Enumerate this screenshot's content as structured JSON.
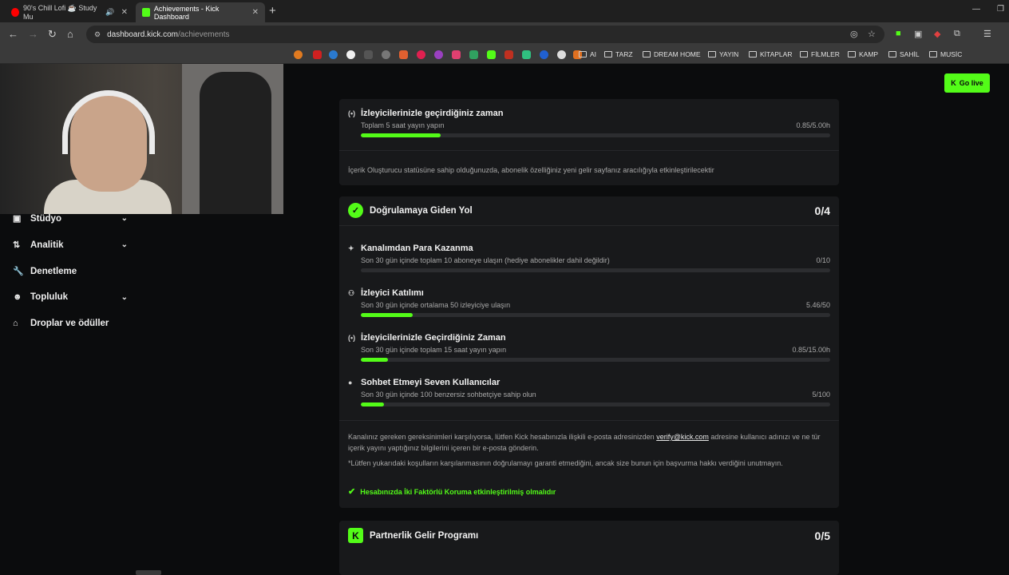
{
  "browser": {
    "tabs": [
      {
        "title": "90's Chill Lofi ☕ Study Mu",
        "favicon_color": "#ff0000"
      },
      {
        "title": "Achievements - Kick Dashboard",
        "favicon_color": "#53fc18"
      }
    ],
    "url_host": "dashboard.kick.com",
    "url_path": "/achievements",
    "bookmark_folders": [
      "AI",
      "TARZ",
      "DREAM HOME",
      "YAYIN",
      "KİTAPLAR",
      "FİLMLER",
      "KAMP",
      "SAHİL",
      "MUSİC"
    ]
  },
  "header": {
    "go_live_label": "Go live"
  },
  "sidebar": {
    "items": [
      {
        "label": "Stüdyo",
        "icon": "studio-icon",
        "has_chevron": true
      },
      {
        "label": "Analitik",
        "icon": "analytics-icon",
        "has_chevron": true
      },
      {
        "label": "Denetleme",
        "icon": "wrench-icon",
        "has_chevron": false
      },
      {
        "label": "Topluluk",
        "icon": "community-icon",
        "has_chevron": true
      },
      {
        "label": "Droplar ve ödüller",
        "icon": "gift-icon",
        "has_chevron": false
      }
    ]
  },
  "creator_card": {
    "req": {
      "title": "İzleyicilerinizle geçirdiğiniz zaman",
      "subtitle": "Toplam 5 saat yayın yapın",
      "value": "0.85/5.00h",
      "progress": 0.17
    },
    "note": "İçerik Oluşturucu statüsüne sahip olduğunuzda, abonelik özelliğiniz yeni gelir sayfanız aracılığıyla etkinleştirilecektir"
  },
  "verification_card": {
    "title": "Doğrulamaya Giden Yol",
    "count": "0/4",
    "requirements": [
      {
        "title": "Kanalımdan Para Kazanma",
        "subtitle": "Son 30 gün içinde toplam 10 aboneye ulaşın (hediye abonelikler dahil değildir)",
        "value": "0/10",
        "progress": 0.0,
        "icon": "sparkle-icon"
      },
      {
        "title": "İzleyici Katılımı",
        "subtitle": "Son 30 gün içinde ortalama 50 izleyiciye ulaşın",
        "value": "5.46/50",
        "progress": 0.11,
        "icon": "viewers-icon"
      },
      {
        "title": "İzleyicilerinizle Geçirdiğiniz Zaman",
        "subtitle": "Son 30 gün içinde toplam 15 saat yayın yapın",
        "value": "0.85/15.00h",
        "progress": 0.057,
        "icon": "broadcast-icon"
      },
      {
        "title": "Sohbet Etmeyi Seven Kullanıcılar",
        "subtitle": "Son 30 gün içinde 100 benzersiz sohbetçiye sahip olun",
        "value": "5/100",
        "progress": 0.05,
        "icon": "chat-icon"
      }
    ],
    "note1_a": "Kanalınız gereken gereksinimleri karşılıyorsa, lütfen Kick hesabınızla ilişkili e-posta adresinizden",
    "note1_link": "verify@kick.com",
    "note1_b": "adresine kullanıcı adınızı ve ne tür içerik yayını yaptığınız bilgilerini içeren bir e-posta gönderin.",
    "note2": "*Lütfen yukarıdaki koşulların karşılanmasının doğrulamayı garanti etmediğini, ancak size bunun için başvurma hakkı verdiğini unutmayın.",
    "twofa": "Hesabınızda İki Faktörlü Koruma etkinleştirilmiş olmalıdır"
  },
  "partner_card": {
    "title": "Partnerlik Gelir Programı",
    "count": "0/5"
  },
  "colors": {
    "accent": "#53fc18",
    "card_bg": "#18191b",
    "page_bg": "#0b0c0d"
  }
}
